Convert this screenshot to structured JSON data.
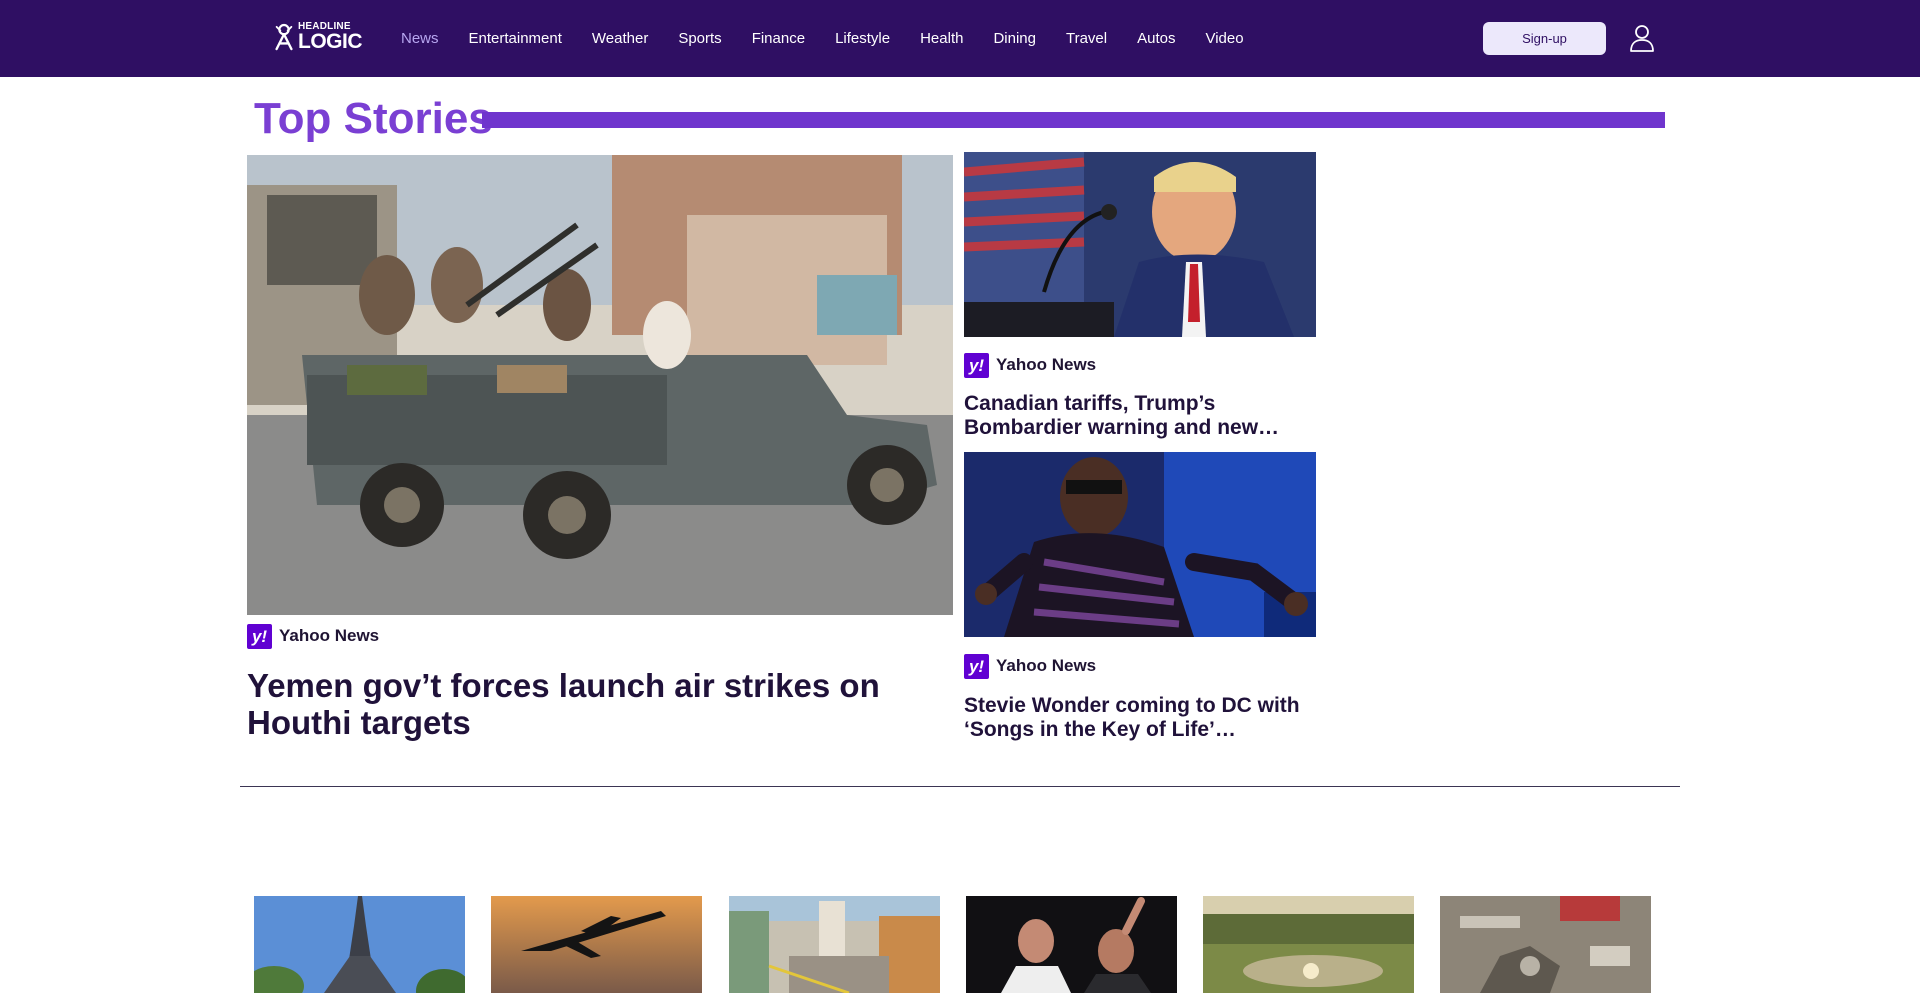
{
  "brand": {
    "logo_top": "HEADLINE",
    "logo_bottom": "LOGIC",
    "header_bg": "#2f0f63",
    "accent": "#7a3fd3"
  },
  "nav": {
    "items": [
      "News",
      "Entertainment",
      "Weather",
      "Sports",
      "Finance",
      "Lifestyle",
      "Health",
      "Dining",
      "Travel",
      "Autos",
      "Video"
    ],
    "active": "News"
  },
  "header": {
    "signup_label": "Sign-up",
    "user_icon": "user-icon"
  },
  "section": {
    "title": "Top Stories"
  },
  "stories": [
    {
      "source": "Yahoo News",
      "headline": "Yemen gov’t forces launch air strikes on Houthi targets",
      "image": "armed men on pickup truck"
    },
    {
      "source": "Yahoo News",
      "headline": "Canadian tariffs, Trump’s Bombardier warning and new…",
      "image": "speaker at podium"
    },
    {
      "source": "Yahoo News",
      "headline": "Stevie Wonder coming to DC with ‘Songs in the Key of Life’…",
      "image": "performer on stage"
    }
  ],
  "source_badge": {
    "glyph": "y!",
    "color": "#6001d2"
  },
  "bottom_cards": [
    {
      "image": "eiffel tower"
    },
    {
      "image": "airplane silhouette"
    },
    {
      "image": "damaged street"
    },
    {
      "image": "concert performers"
    },
    {
      "image": "golf course sunset"
    },
    {
      "image": "debris on ground"
    }
  ]
}
